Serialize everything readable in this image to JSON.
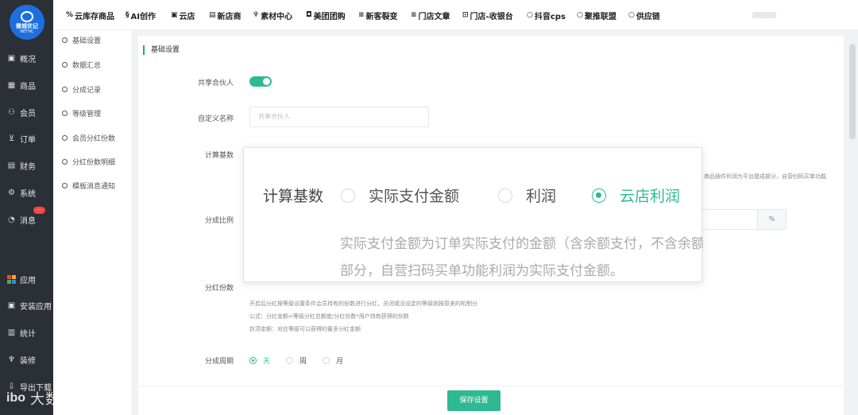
{
  "brand": {
    "logo_line1": "微城优记",
    "logo_line2": "NETHC"
  },
  "sidebar": {
    "items": [
      {
        "label": "概况",
        "icon": "overview-icon"
      },
      {
        "label": "商品",
        "icon": "goods-icon"
      },
      {
        "label": "会员",
        "icon": "member-icon"
      },
      {
        "label": "订单",
        "icon": "cart-icon"
      },
      {
        "label": "财务",
        "icon": "finance-icon"
      },
      {
        "label": "系统",
        "icon": "gear-icon"
      },
      {
        "label": "消息",
        "icon": "message-icon"
      },
      {
        "label": "应用",
        "icon": "apps-icon"
      },
      {
        "label": "安装应用",
        "icon": "install-icon"
      },
      {
        "label": "统计",
        "icon": "stats-icon"
      },
      {
        "label": "装修",
        "icon": "decorate-icon"
      },
      {
        "label": "导出下载",
        "icon": "download-icon"
      }
    ]
  },
  "topnav": {
    "items": [
      "云库存商品",
      "AI创作",
      "云店",
      "新店商",
      "素材中心",
      "美团团购",
      "新客裂变",
      "门店文章",
      "门店-收银台",
      "抖音cps",
      "聚推联盟",
      "供应链"
    ]
  },
  "submenu": {
    "items": [
      "基础设置",
      "数据汇总",
      "分成记录",
      "等级管理",
      "会员分红份数",
      "分红份数明细",
      "模板消息通知"
    ]
  },
  "form": {
    "section_title": "基础设置",
    "partner_label": "共享合伙人",
    "custom_name_label": "自定义名称",
    "custom_name_placeholder": "共享合伙人",
    "calc_base_label": "计算基数",
    "calc_hint_right": "商品插件利润为平台提成部分，自营扫码买单功能",
    "ratio_label": "分成比例",
    "ratio_suffix": "%",
    "share_label": "分红份数",
    "share_note1": "开启后分红按等级设置条件会员持有的份数进行分红，关闭或没设定的等级则按原来的机制分",
    "share_note2": "公式：分红金额=等级分红总额度/分红份数*用户持有获得的份数",
    "share_note3": "封顶金额：对应等级可以获得的最多分红金额",
    "period_label": "分成周期",
    "period_options": [
      {
        "label": "天",
        "checked": true
      },
      {
        "label": "周",
        "checked": false
      },
      {
        "label": "月",
        "checked": false
      }
    ],
    "save_button": "保存设置"
  },
  "popup": {
    "label": "计算基数",
    "options": [
      {
        "label": "实际支付金额",
        "checked": false
      },
      {
        "label": "利润",
        "checked": false
      },
      {
        "label": "云店利润",
        "checked": true
      }
    ],
    "desc_line1": "实际支付金额为订单实际支付的金额（含余额支付，不含余额",
    "desc_line2": "部分，自营扫码买单功能利润为实际支付金额。"
  },
  "badge": {
    "count": "···"
  },
  "watermark": {
    "logo": "ibo",
    "text": "大数跨境"
  },
  "colors": {
    "accent": "#2eb992",
    "sidebar_bg": "#2b2f36",
    "logo_blue": "#1d6fe0"
  }
}
